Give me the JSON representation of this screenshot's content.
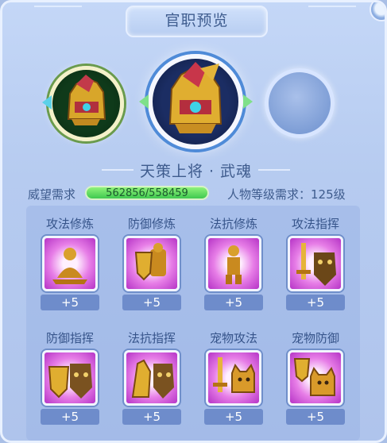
{
  "title": "官职预览",
  "rank_name": "天策上将 · 武魂",
  "prestige": {
    "label": "威望需求",
    "value": "562856/558459"
  },
  "level_requirement": "人物等级需求：125级",
  "emblems": [
    {
      "name": "previous-rank-emblem",
      "icon": "golden-helmet-icon"
    },
    {
      "name": "current-rank-emblem",
      "icon": "golden-helmet-icon"
    },
    {
      "name": "next-rank-emblem",
      "icon": "empty-slot"
    }
  ],
  "bonuses": [
    {
      "label": "攻法修炼",
      "value": "+5",
      "icon": "meditating-figure-icon"
    },
    {
      "label": "防御修炼",
      "value": "+5",
      "icon": "armor-shield-icon"
    },
    {
      "label": "法抗修炼",
      "value": "+5",
      "icon": "golden-figure-icon"
    },
    {
      "label": "攻法指挥",
      "value": "+5",
      "icon": "sword-tiger-icon"
    },
    {
      "label": "防御指挥",
      "value": "+5",
      "icon": "shield-tiger-icon"
    },
    {
      "label": "法抗指挥",
      "value": "+5",
      "icon": "hand-tiger-icon"
    },
    {
      "label": "宠物攻法",
      "value": "+5",
      "icon": "sword-cat-icon"
    },
    {
      "label": "宠物防御",
      "value": "+5",
      "icon": "shield-cat-icon"
    }
  ],
  "colors": {
    "accent": "#3e5b8d",
    "bar": "#3fc84f",
    "icon_bg": "#c94ed6"
  }
}
